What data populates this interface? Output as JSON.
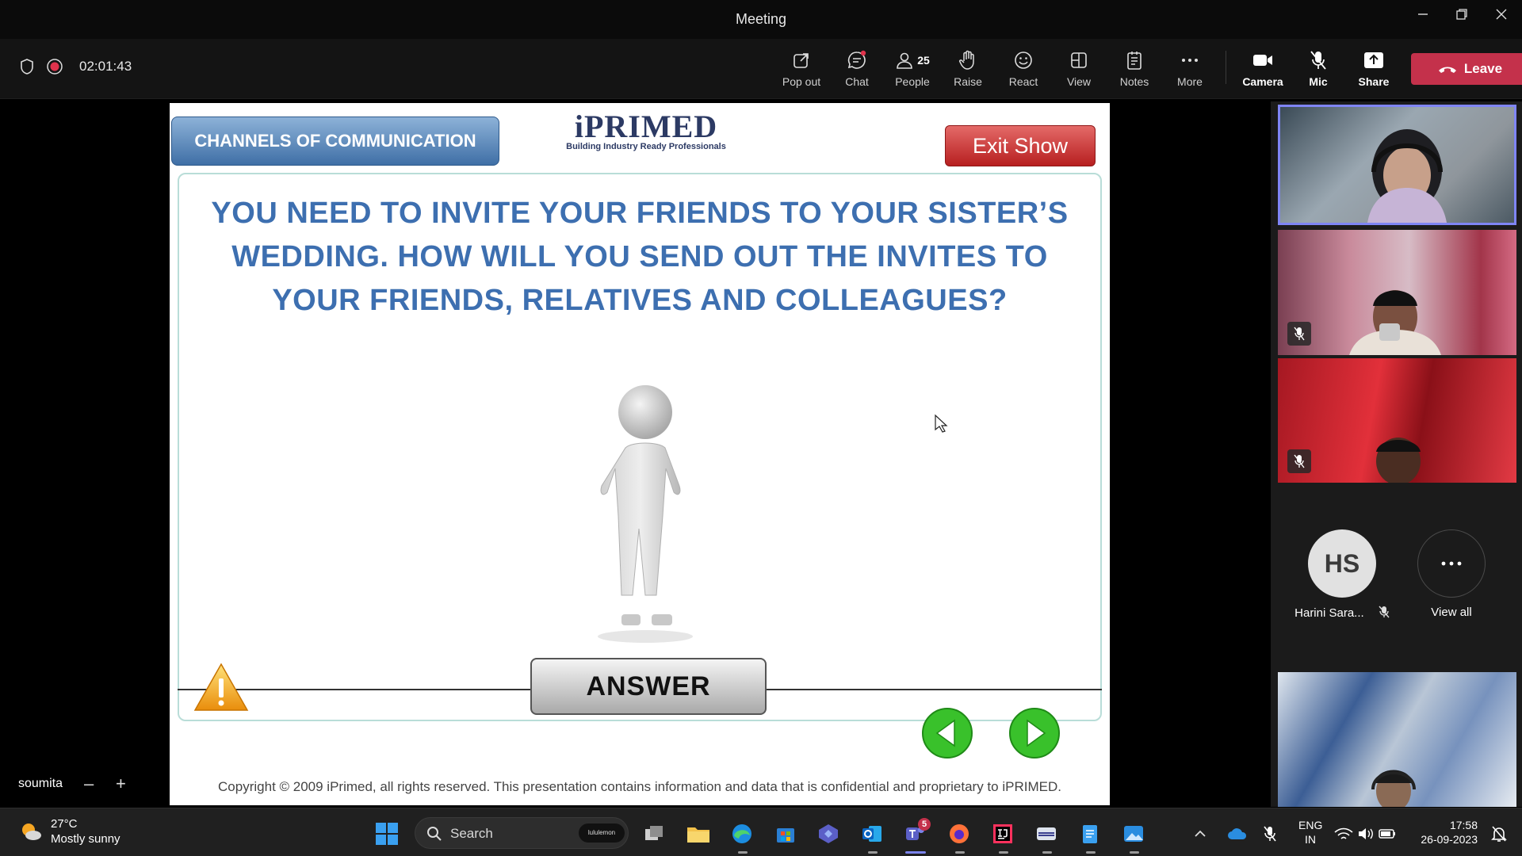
{
  "window": {
    "title": "Meeting"
  },
  "toolbar": {
    "timer": "02:01:43",
    "popout_label": "Pop out",
    "chat_label": "Chat",
    "people_label": "People",
    "people_count": "25",
    "raise_label": "Raise",
    "react_label": "React",
    "view_label": "View",
    "notes_label": "Notes",
    "more_label": "More",
    "camera_label": "Camera",
    "mic_label": "Mic",
    "share_label": "Share",
    "leave_label": "Leave"
  },
  "slide": {
    "section_title": "CHANNELS OF COMMUNICATION",
    "logo_text": "iPRIMED",
    "logo_tagline": "Building Industry Ready Professionals",
    "exit_label": "Exit Show",
    "question_line1": "YOU NEED TO INVITE YOUR FRIENDS TO YOUR SISTER’S",
    "question_line2": "WEDDING. HOW WILL YOU SEND OUT THE INVITES TO",
    "question_line3": "YOUR FRIENDS, RELATIVES AND COLLEAGUES?",
    "answer_label": "ANSWER",
    "copyright": "Copyright © 2009 iPrimed, all rights reserved. This presentation contains information  and data  that is confidential and proprietary to iPRIMED."
  },
  "presenter": {
    "name": "soumita"
  },
  "participants": {
    "avatar_initials": "HS",
    "avatar_name": "Harini Sara...",
    "view_all_label": "View all"
  },
  "taskbar": {
    "temperature": "27°C",
    "weather": "Mostly sunny",
    "search_placeholder": "Search",
    "search_badge": "lululemon",
    "teams_badge": "5",
    "lang1": "ENG",
    "lang2": "IN",
    "time": "17:58",
    "date": "26-09-2023"
  },
  "colors": {
    "accent": "#7f85f5",
    "leave": "#c4314b",
    "title_blue": "#3d6fb0"
  }
}
